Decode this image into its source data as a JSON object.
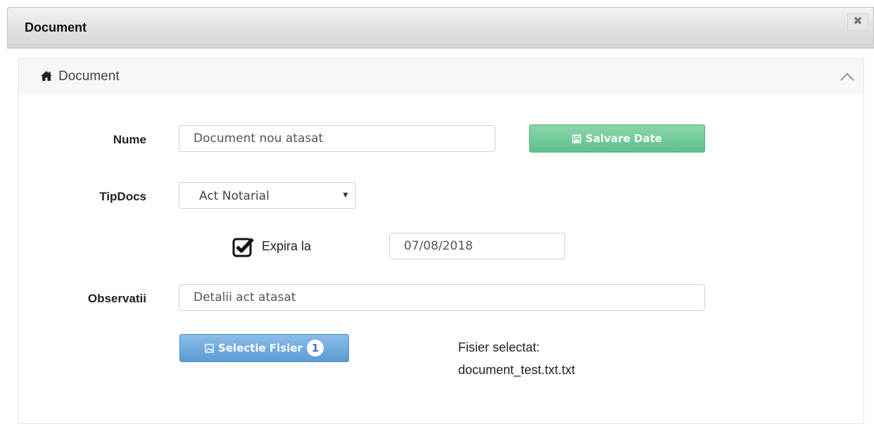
{
  "window": {
    "title": "Document",
    "close_glyph": "✖"
  },
  "panel": {
    "title": "Document",
    "icons": {
      "header": "home-icon",
      "collapse": "chevron-up-icon"
    }
  },
  "form": {
    "nume": {
      "label": "Nume",
      "value": "Document nou atasat"
    },
    "save_button": {
      "label": "Salvare Date",
      "icon": "floppy-disk-icon"
    },
    "tipdocs": {
      "label": "TipDocs",
      "selected": "Act Notarial",
      "arrow": "▼"
    },
    "expira": {
      "label": "Expira la",
      "checked": true,
      "date": "07/08/2018"
    },
    "observatii": {
      "label": "Observatii",
      "value": "Detalii act atasat"
    },
    "file_button": {
      "label": "Selectie Fisier",
      "icon": "image-file-icon",
      "badge": "1"
    },
    "selected_file": {
      "label": "Fisier selectat:",
      "name": "document_test.txt.txt"
    }
  },
  "colors": {
    "save_button": "#6fc797",
    "file_button": "#6aa8dc",
    "titlebar": "#dcdcdc"
  }
}
